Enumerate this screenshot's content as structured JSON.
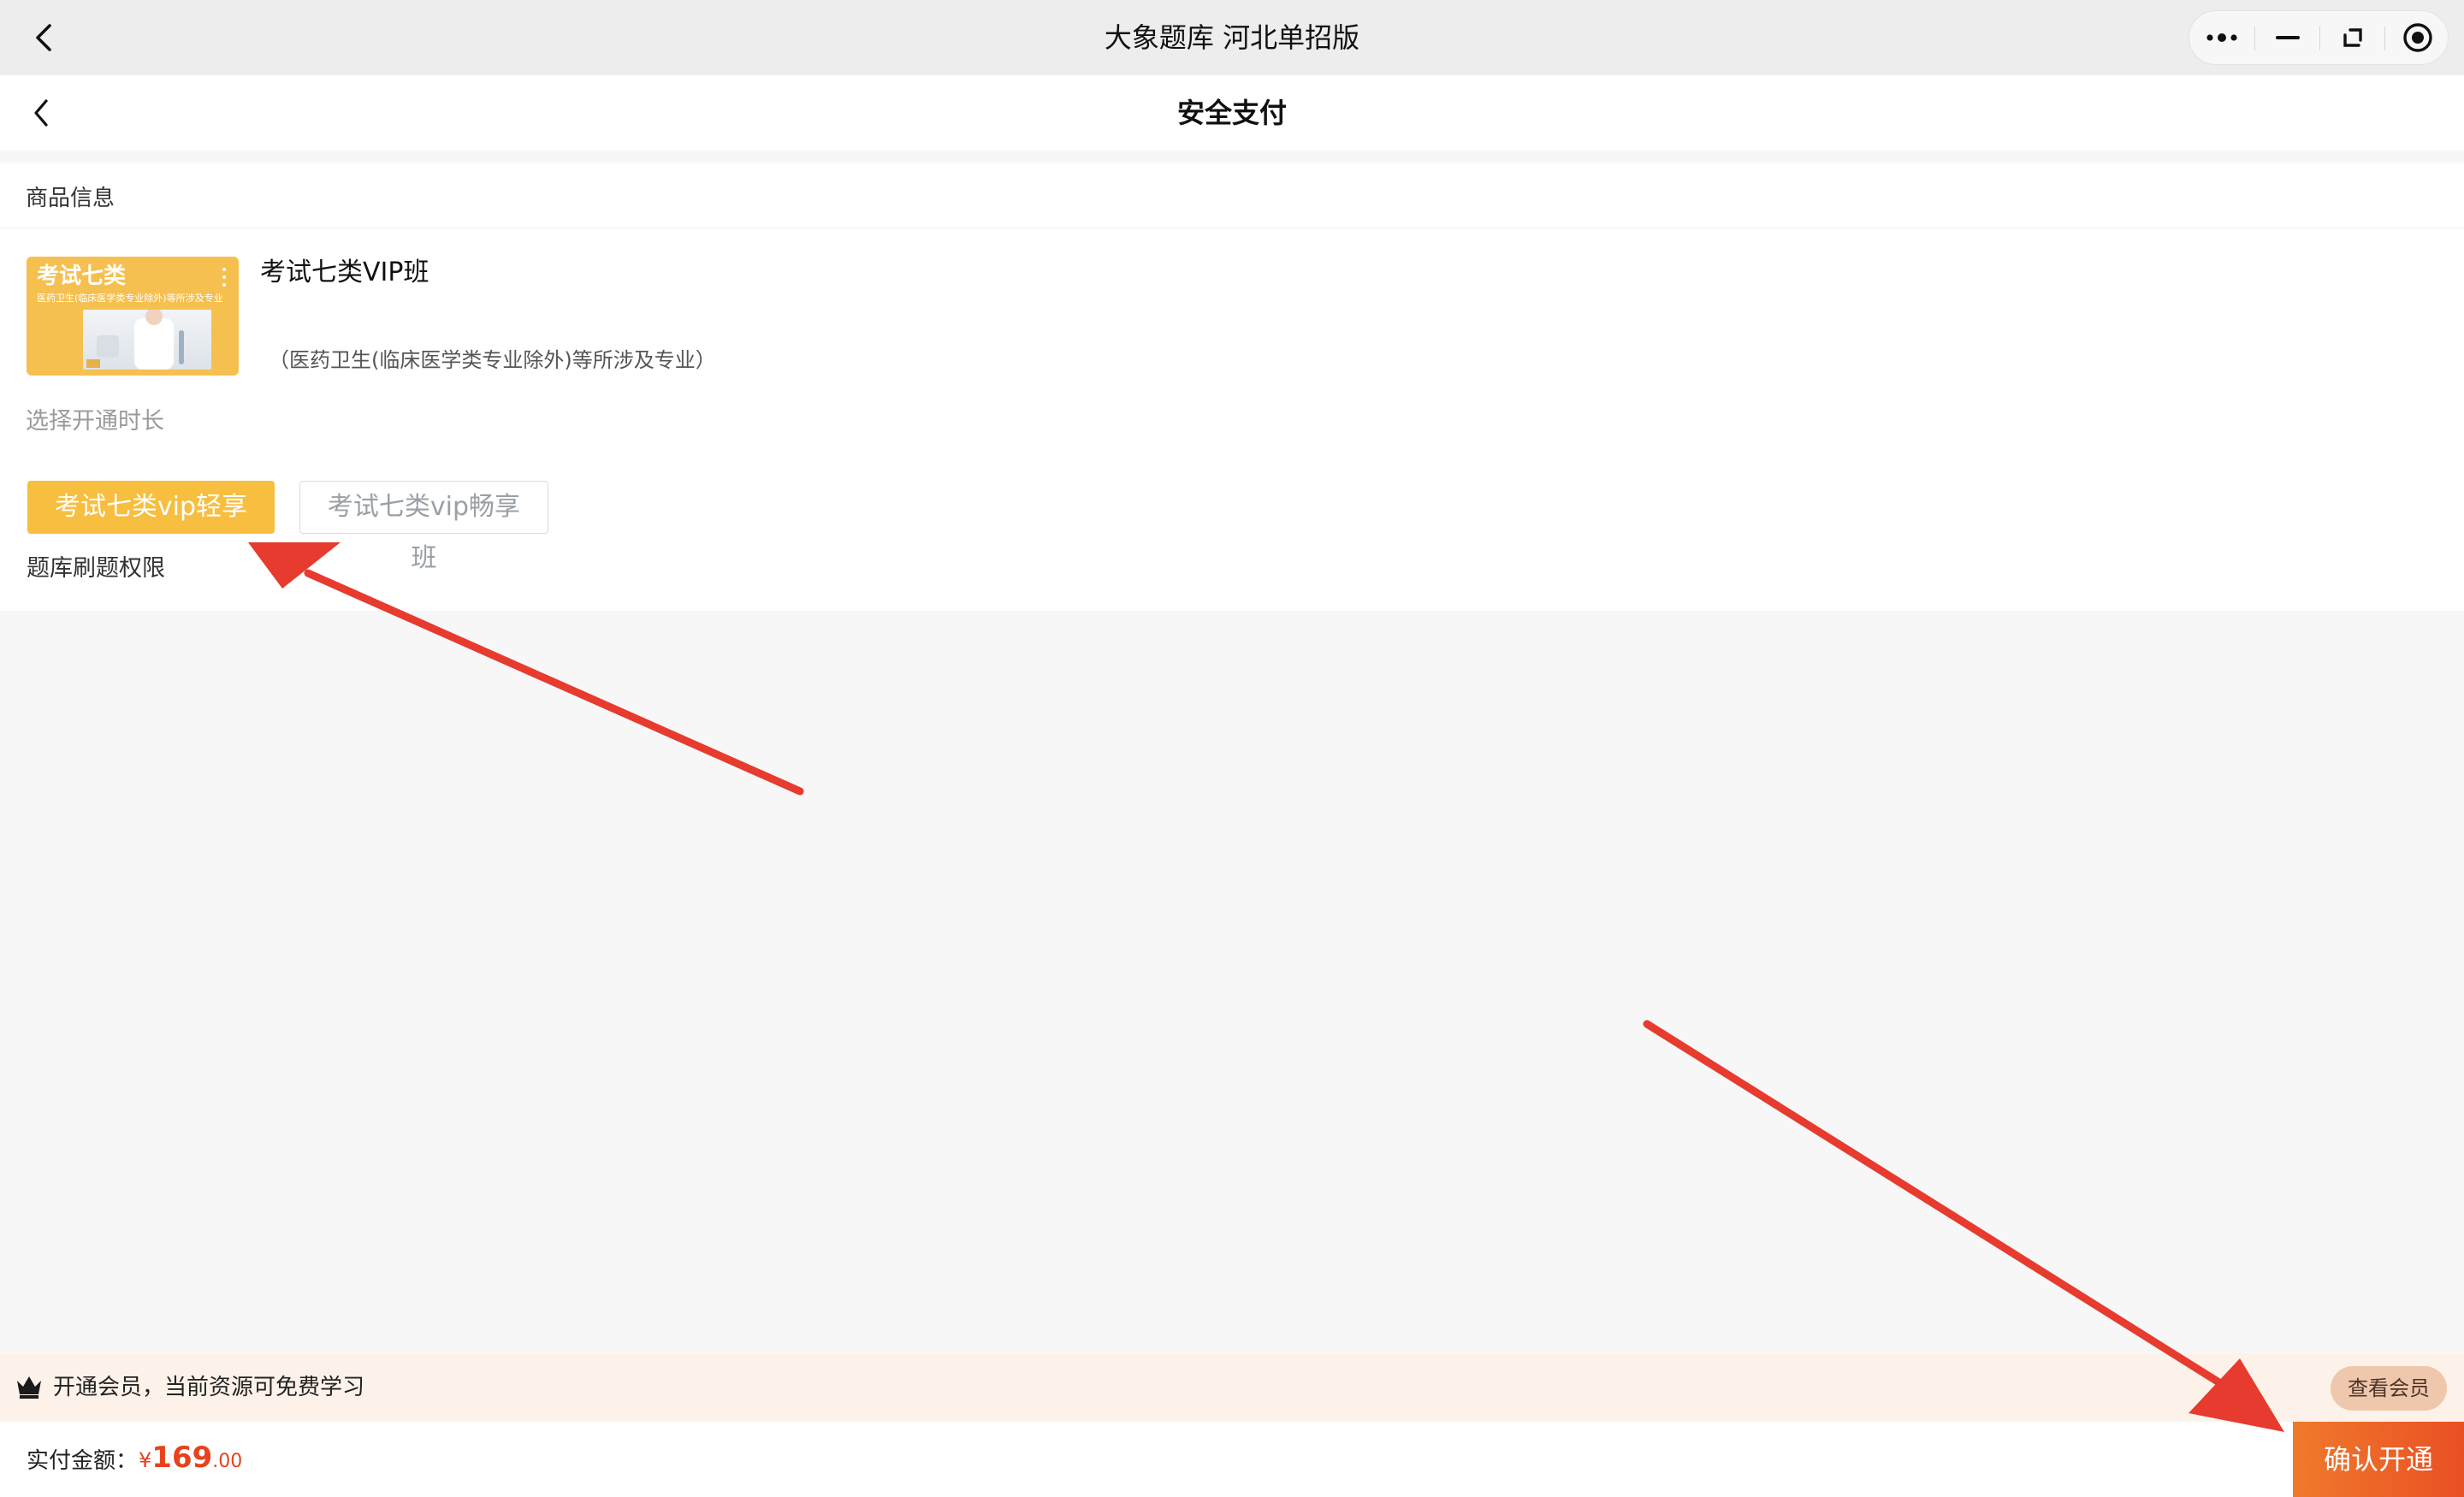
{
  "titlebar": {
    "app_title": "大象题库 河北单招版",
    "capsule_icons": [
      "more-icon",
      "minimize-icon",
      "restore-icon",
      "record-icon"
    ]
  },
  "navbar": {
    "title": "安全支付"
  },
  "product": {
    "section_title": "商品信息",
    "thumbnail": {
      "title": "考试七类",
      "subtitle": "医药卫生(临床医学类专业除外)等所涉及专业"
    },
    "name": "考试七类VIP班",
    "description": "（医药卫生(临床医学类专业除外)等所涉及专业）",
    "duration_label": "选择开通时长",
    "plans": [
      {
        "label": "考试七类vip轻享班",
        "selected": true
      },
      {
        "label": "考试七类vip畅享班",
        "selected": false
      }
    ],
    "permission_label": "题库刷题权限"
  },
  "member": {
    "text": "开通会员，当前资源可免费学习",
    "button": "查看会员"
  },
  "pay": {
    "label": "实付金额：",
    "currency": "¥",
    "amount_int": "169",
    "amount_dec": ".00",
    "confirm": "确认开通"
  },
  "colors": {
    "accent_yellow": "#f7be3f",
    "price_red": "#e8411e",
    "confirm_orange": "#f07a2c",
    "annotation_red": "#e63b2e"
  }
}
